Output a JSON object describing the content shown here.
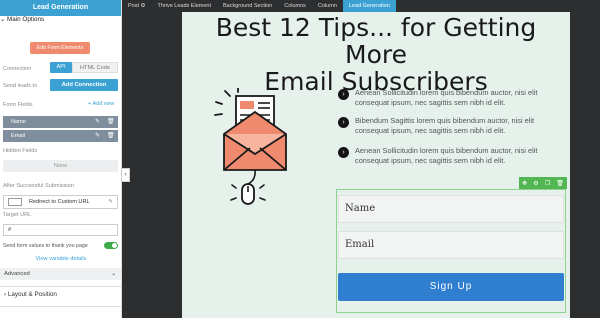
{
  "panel": {
    "title": "Lead Generation",
    "main_options": "Main Options",
    "edit_form_elements": "Edit Form Elements",
    "connection_label": "Connection",
    "api_tab": "API",
    "html_tab": "HTML Code",
    "send_leads_label": "Send leads to",
    "add_connection": "Add Connection",
    "form_fields_label": "Form Fields",
    "add_new": "Add new",
    "fields": [
      "Name",
      "Email"
    ],
    "hidden_fields_label": "Hidden Fields",
    "hidden_none": "None",
    "after_submission_label": "After Successful Submission",
    "redirect_option": "Redirect to Custom URL",
    "target_url_label": "Target URL",
    "target_url_value": "#",
    "send_values_label": "Send form values to thank you page",
    "send_values_enabled": true,
    "view_variables": "View variable details",
    "advanced": "Advanced",
    "layout_position": "Layout & Position"
  },
  "breadcrumbs": [
    "Post",
    "Thrive Leads Element",
    "Background Section",
    "Columns",
    "Column",
    "Lead Generation"
  ],
  "canvas": {
    "title_line1": "Best 12 Tips... for Getting More",
    "title_line2": "Email Subscribers",
    "bullets": [
      "Aenean Sollicitudin lorem quis bibendum auctor, nisi elit consequat ipsum, nec sagittis sem nibh id elit.",
      "Bibendum Sagittis lorem quis bibendum auctor, nisi elit consequat ipsum, nec sagittis sem nibh id elit.",
      "Aenean Sollicitudin lorem quis bibendum auctor, nisi elit consequat ipsum, nec sagittis sem nibh id elit."
    ],
    "form": {
      "name_placeholder": "Name",
      "email_placeholder": "Email",
      "submit_label": "Sign Up"
    }
  },
  "colors": {
    "accent": "#3ba1d3",
    "canvas_bg": "#e6f1ec",
    "edit_button": "#f08a6e",
    "submit_button": "#2f7ecf",
    "illustration": "#f08a6e"
  }
}
